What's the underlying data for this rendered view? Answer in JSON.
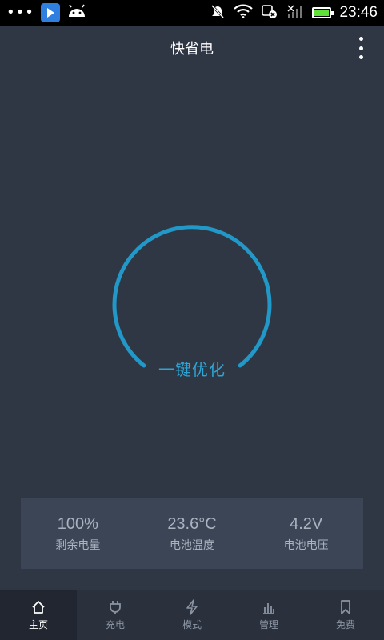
{
  "status_bar": {
    "time": "23:46",
    "battery_level": 1.0,
    "icons": [
      "more-dots-icon",
      "play-store-icon",
      "android-icon",
      "mute-icon",
      "wifi-icon",
      "sync-blocked-icon",
      "signal-icon",
      "battery-icon"
    ]
  },
  "app": {
    "title": "快省电"
  },
  "gauge": {
    "label": "一键优化",
    "color": "#2da6d6"
  },
  "stats": [
    {
      "value": "100%",
      "label": "剩余电量"
    },
    {
      "value": "23.6°C",
      "label": "电池温度"
    },
    {
      "value": "4.2V",
      "label": "电池电压"
    }
  ],
  "nav": [
    {
      "label": "主页",
      "icon": "home-icon",
      "active": true
    },
    {
      "label": "充电",
      "icon": "plug-icon"
    },
    {
      "label": "模式",
      "icon": "lightning-icon"
    },
    {
      "label": "管理",
      "icon": "bar-chart-icon"
    },
    {
      "label": "免费",
      "icon": "bookmark-icon"
    }
  ]
}
